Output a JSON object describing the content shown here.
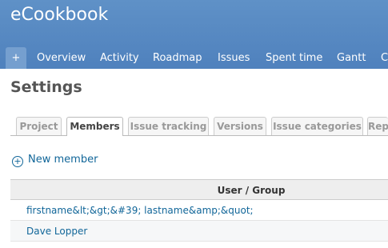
{
  "header": {
    "app_title": "eCookbook",
    "plus_label": "+",
    "menu": [
      "Overview",
      "Activity",
      "Roadmap",
      "Issues",
      "Spent time",
      "Gantt",
      "C"
    ]
  },
  "page": {
    "title": "Settings"
  },
  "tabs": [
    {
      "label": "Project",
      "selected": false
    },
    {
      "label": "Members",
      "selected": true
    },
    {
      "label": "Issue tracking",
      "selected": false
    },
    {
      "label": "Versions",
      "selected": false
    },
    {
      "label": "Issue categories",
      "selected": false
    },
    {
      "label": "Rep",
      "selected": false
    }
  ],
  "new_member": {
    "icon": "add-circle-icon",
    "label": "New member"
  },
  "members_table": {
    "columns": [
      "User / Group"
    ],
    "rows": [
      {
        "user": "firstname&lt;&gt;&#39; lastname&amp;&quot;"
      },
      {
        "user": "Dave Lopper"
      }
    ]
  },
  "colors": {
    "header": "#4f81bd",
    "link": "#116699"
  }
}
